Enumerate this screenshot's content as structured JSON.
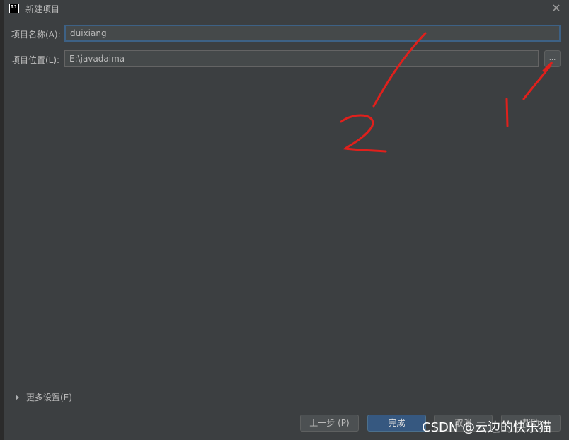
{
  "window": {
    "title": "新建项目",
    "icon": "intellij-idea-icon",
    "close_label": "✕"
  },
  "form": {
    "name": {
      "label": "项目名称(A):",
      "value": "duixiang"
    },
    "location": {
      "label": "项目位置(L):",
      "value": "E:\\javadaima",
      "browse_label": "..."
    }
  },
  "more_settings": {
    "label": "更多设置(E)"
  },
  "buttons": {
    "previous": "上一步 (P)",
    "finish": "完成",
    "cancel": "取消",
    "help": "帮助"
  },
  "watermark": "CSDN @云边的快乐猫",
  "annotations": {
    "mark_1": "1",
    "mark_2": "2",
    "color": "#e0201c"
  }
}
